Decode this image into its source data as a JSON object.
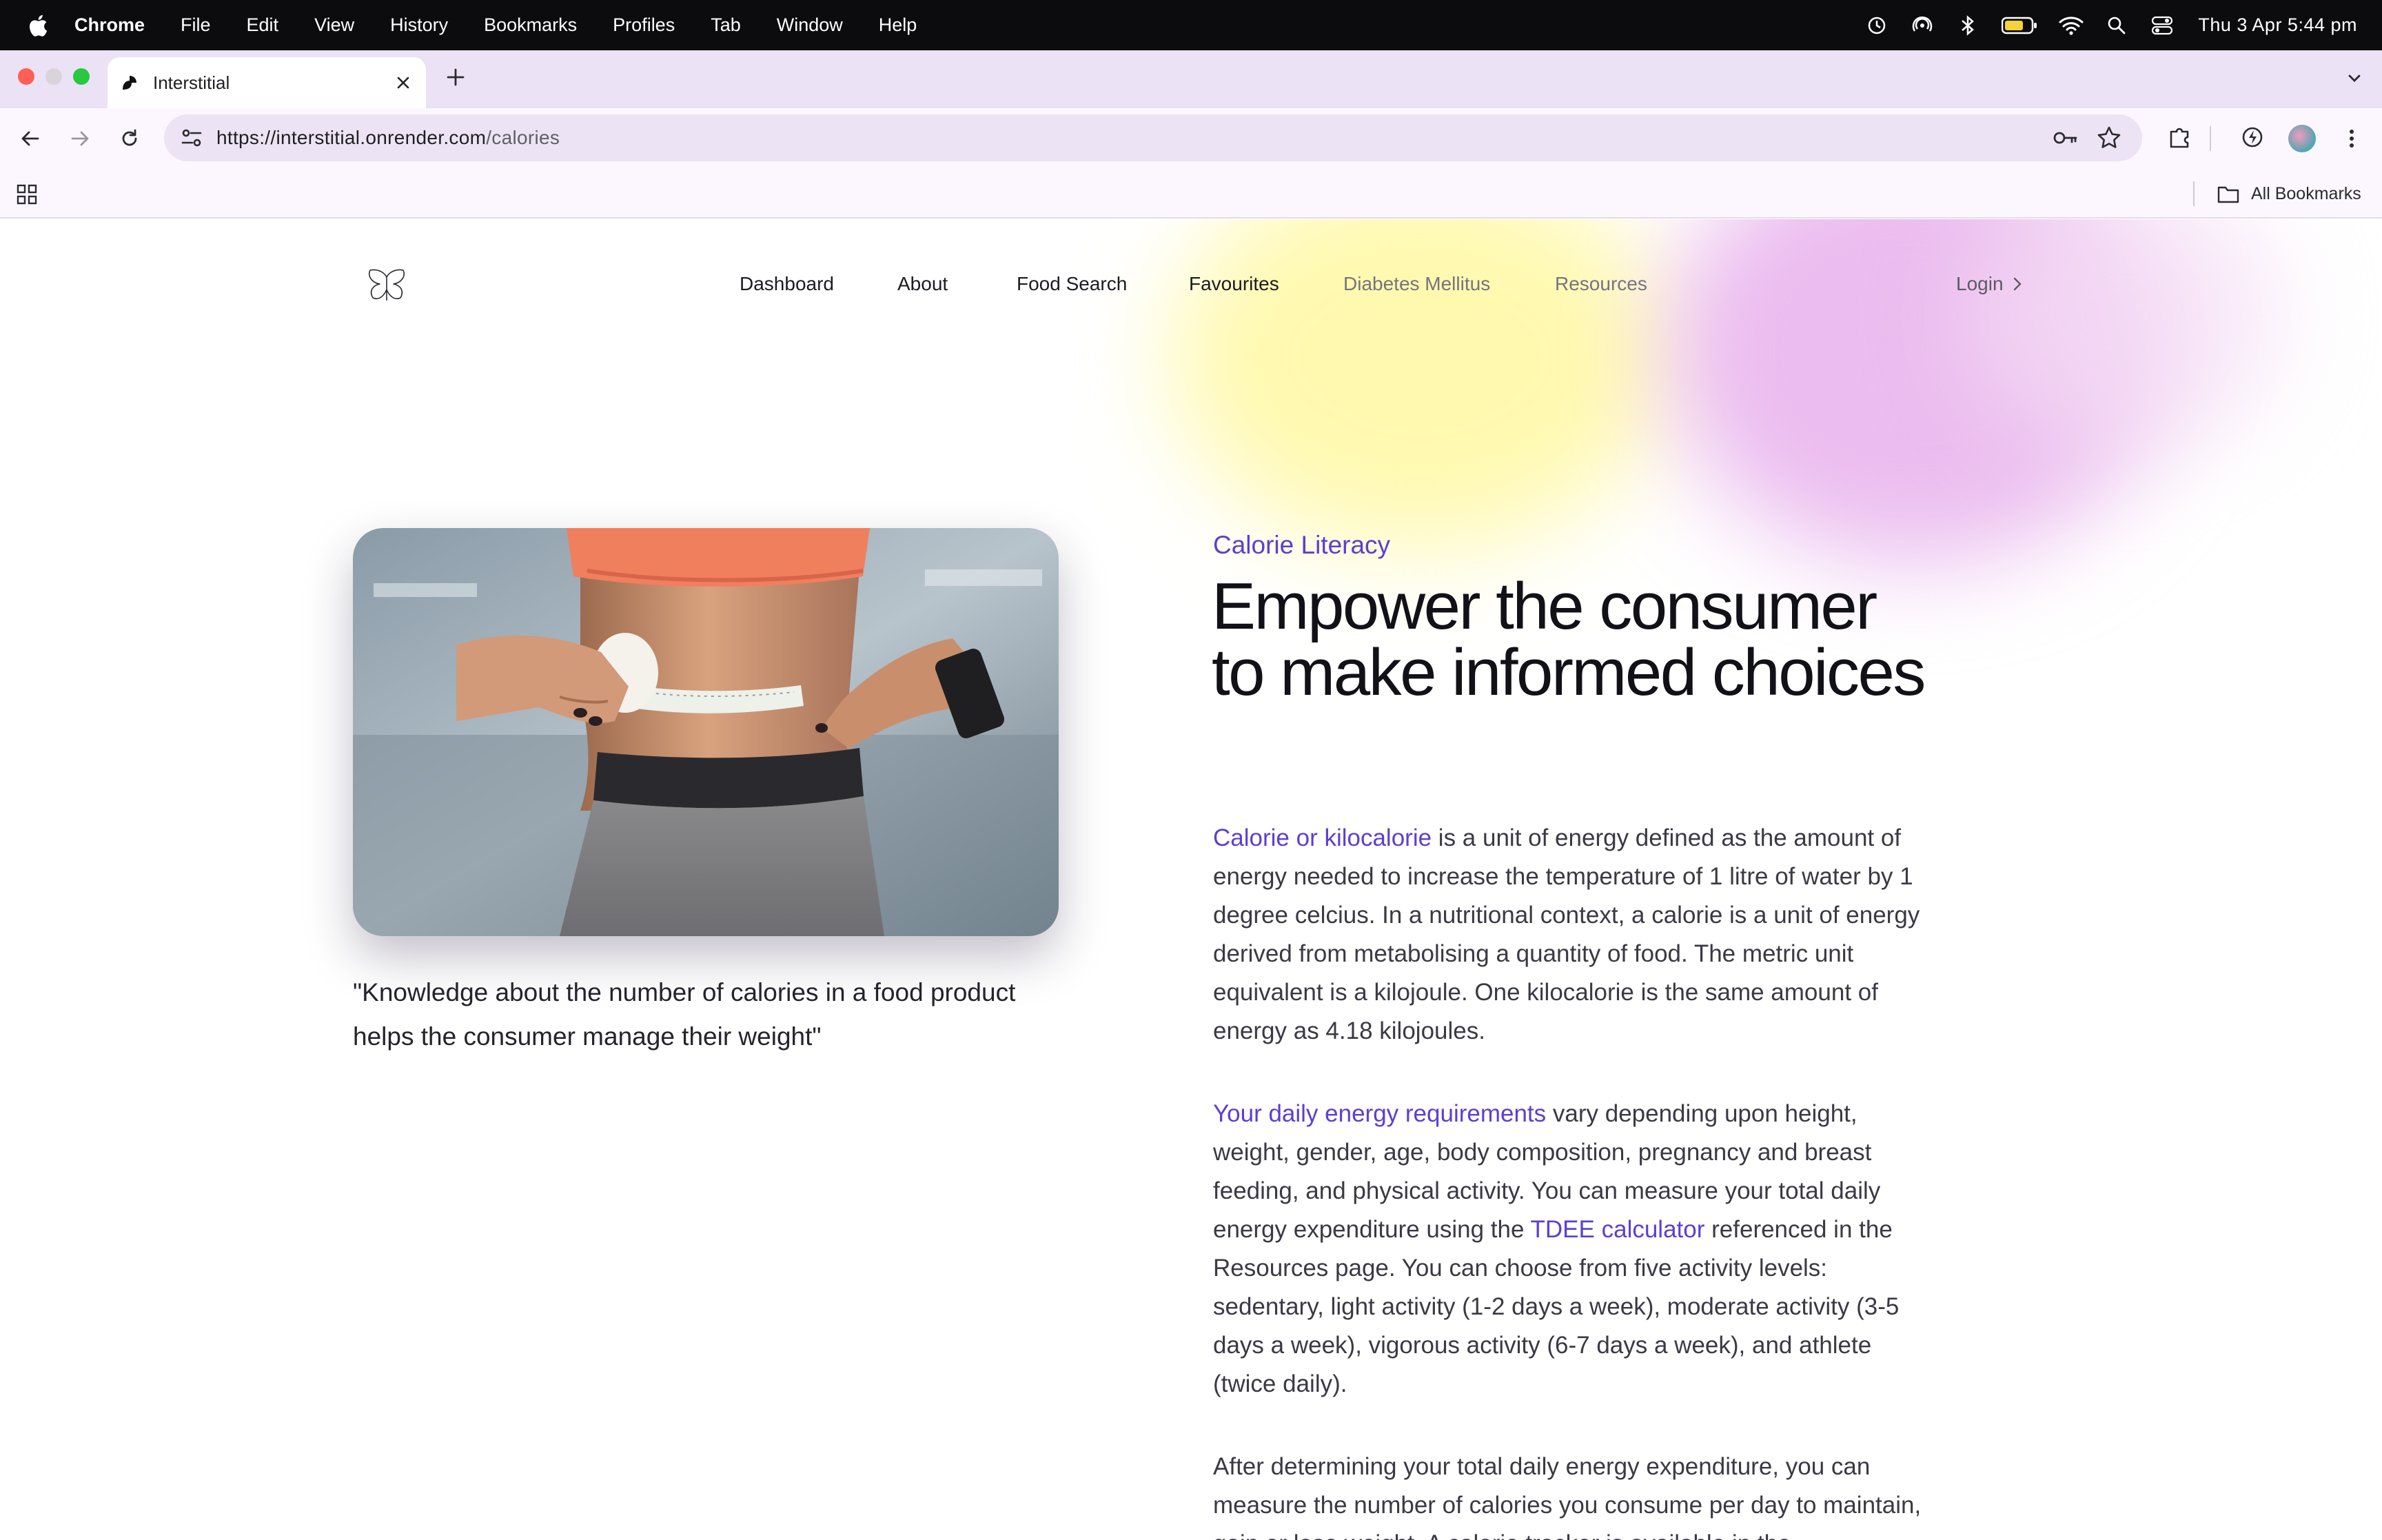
{
  "menubar": {
    "app": "Chrome",
    "items": [
      "File",
      "Edit",
      "View",
      "History",
      "Bookmarks",
      "Profiles",
      "Tab",
      "Window",
      "Help"
    ],
    "clock": "Thu 3 Apr  5:44 pm"
  },
  "browser": {
    "tab": {
      "title": "Interstitial"
    },
    "url": {
      "host": "https://interstitial.onrender.com",
      "path": "/calories"
    },
    "bookmarks": {
      "all_label": "All Bookmarks"
    }
  },
  "nav": {
    "links": [
      "Dashboard",
      "About",
      "Food Search",
      "Favourites",
      "Diabetes Mellitus",
      "Resources"
    ],
    "login": "Login"
  },
  "hero": {
    "quote": "\"Knowledge about the number of calories in a food product helps the consumer manage their weight\"",
    "eyebrow": "Calorie Literacy",
    "headline": "Empower the consumer to make informed choices"
  },
  "content": {
    "p1": {
      "link": "Calorie or kilocalorie",
      "text": " is a unit of energy defined as the amount of energy needed to increase the temperature of 1 litre of water by 1 degree celcius. In a nutritional context, a calorie is a unit of energy derived from metabolising a quantity of food. The metric unit equivalent is a kilojoule. One kilocalorie is the same amount of energy as 4.18 kilojoules."
    },
    "p2": {
      "link": "Your daily energy requirements",
      "text_a": " vary depending upon height, weight, gender, age, body composition, pregnancy and breast feeding, and physical activity. You can measure your total daily energy expenditure using the ",
      "link2": "TDEE calculator",
      "text_b": " referenced in the Resources page. You can choose from five activity levels: sedentary, light activity (1-2 days a week), moderate activity (3-5 days a week), vigorous activity (6-7 days a week), and athlete (twice daily)."
    },
    "p3": {
      "text": "After determining your total daily energy expenditure, you can measure the number of calories you consume per day to maintain, gain or lose weight. A calorie tracker is available in the"
    }
  },
  "colors": {
    "accent": "#5b3fd1",
    "tabstrip": "#ebe2f6",
    "toolbar": "#fcf7ff"
  }
}
